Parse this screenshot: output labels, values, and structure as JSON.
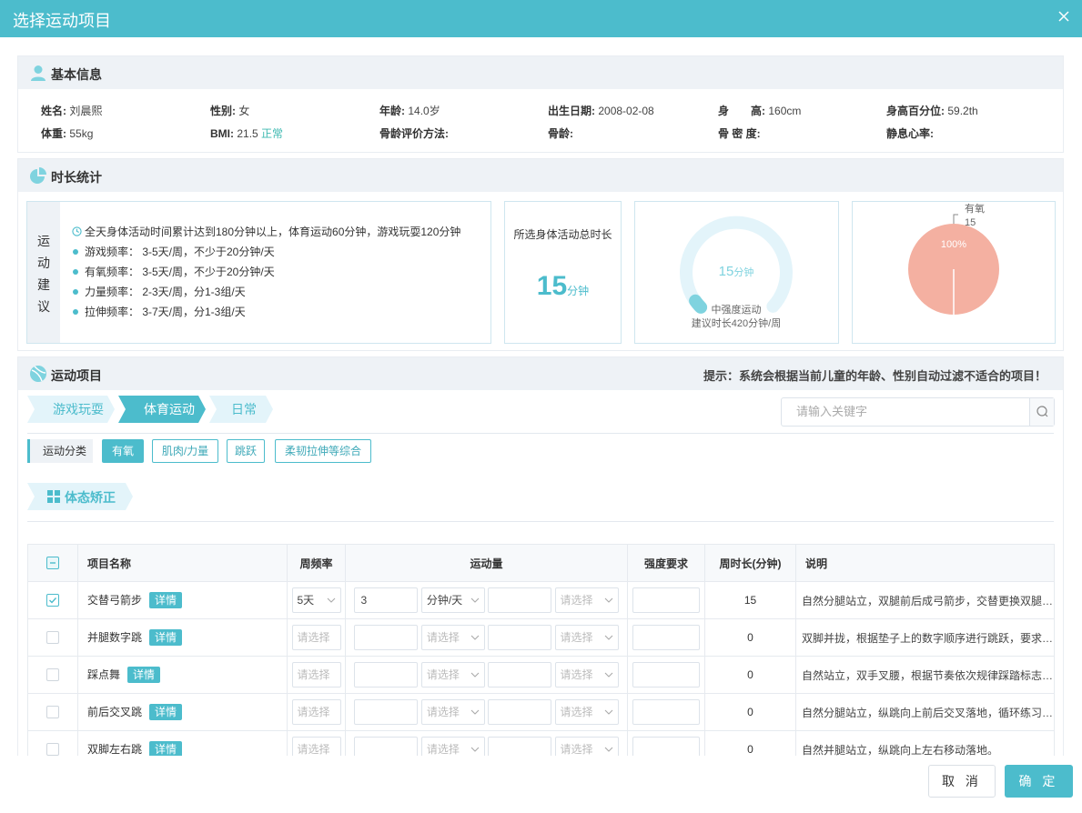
{
  "dialog": {
    "title": "选择运动项目"
  },
  "basic_info": {
    "title": "基本信息",
    "row1": [
      {
        "label": "姓名:",
        "value": "刘晨熙"
      },
      {
        "label": "性别:",
        "value": "女"
      },
      {
        "label": "年龄:",
        "value": "14.0岁"
      },
      {
        "label": "出生日期:",
        "value": "2008-02-08"
      },
      {
        "label": "身　　高:",
        "value": "160cm"
      },
      {
        "label": "身高百分位:",
        "value": "59.2th"
      }
    ],
    "row2": [
      {
        "label": "体重:",
        "value": "55kg"
      },
      {
        "label": "BMI:",
        "value": "21.5",
        "status": "正常"
      },
      {
        "label": "骨龄评价方法:",
        "value": ""
      },
      {
        "label": "骨龄:",
        "value": ""
      },
      {
        "label": "骨 密 度:",
        "value": ""
      },
      {
        "label": "静息心率:",
        "value": ""
      }
    ]
  },
  "duration": {
    "title": "时长统计",
    "advice_side": [
      "运",
      "动",
      "建",
      "议"
    ],
    "advice_summary": "全天身体活动时间累计达到180分钟以上，体育运动60分钟，游戏玩耍120分钟",
    "advice_items": [
      "游戏频率：  3-5天/周，不少于20分钟/天",
      "有氧频率：  3-5天/周，不少于20分钟/天",
      "力量频率：  2-3天/周，分1-3组/天",
      "拉伸频率：  3-7天/周，分1-3组/天"
    ],
    "total_label": "所选身体活动总时长",
    "total_value": "15",
    "total_unit": "分钟",
    "gauge": {
      "value": "15",
      "unit": "分钟",
      "label1": "中强度运动",
      "label2": "建议时长420分钟/周",
      "fraction": 0.036
    },
    "pie": {
      "label": "有氧",
      "value": "15",
      "percent": "100%",
      "color": "#f4b0a1"
    }
  },
  "sport_items": {
    "title": "运动项目",
    "hint": "提示：系统会根据当前儿童的年龄、性别自动过滤不适合的项目！",
    "steps": [
      "游戏玩耍",
      "体育运动",
      "日常"
    ],
    "active_step": 1,
    "search_placeholder": "请输入关键字",
    "category_label": "运动分类",
    "categories": [
      "有氧",
      "肌肉/力量",
      "跳跃",
      "柔韧拉伸等综合"
    ],
    "active_category": 0,
    "posture_label": "体态矫正",
    "table": {
      "headers": [
        "项目名称",
        "周频率",
        "运动量",
        "强度要求",
        "周时长(分钟)",
        "说明"
      ],
      "detail_label": "详情",
      "select_placeholder": "请选择",
      "rows": [
        {
          "checked": true,
          "name": "交替弓箭步",
          "freq": "5天",
          "amount": "3",
          "unit": "分钟/天",
          "minutes": "15",
          "desc": "自然分腿站立，双腿前后成弓箭步，交替更换双腿，每次下蹲至前腿大腿与地面平行"
        },
        {
          "checked": false,
          "name": "并腿数字跳",
          "freq": "",
          "amount": "",
          "unit": "",
          "minutes": "0",
          "desc": "双脚并拢，根据垫子上的数字顺序进行跳跃，要求落地轻柔，保持身体平衡"
        },
        {
          "checked": false,
          "name": "踩点舞",
          "freq": "",
          "amount": "",
          "unit": "",
          "minutes": "0",
          "desc": "自然站立，双手叉腰，根据节奏依次规律踩踏标志点，保持动作协调"
        },
        {
          "checked": false,
          "name": "前后交叉跳",
          "freq": "",
          "amount": "",
          "unit": "",
          "minutes": "0",
          "desc": "自然分腿站立，纵跳向上前后交叉落地，循环练习，保持节奏稳定"
        },
        {
          "checked": false,
          "name": "双脚左右跳",
          "freq": "",
          "amount": "",
          "unit": "",
          "minutes": "0",
          "desc": "自然并腿站立，纵跳向上左右移动落地。"
        }
      ]
    }
  },
  "footer": {
    "cancel": "取 消",
    "ok": "确 定"
  },
  "colors": {
    "accent": "#4cbccc",
    "ok_text": "#3cb8b0",
    "pie": "#f4b0a1"
  }
}
